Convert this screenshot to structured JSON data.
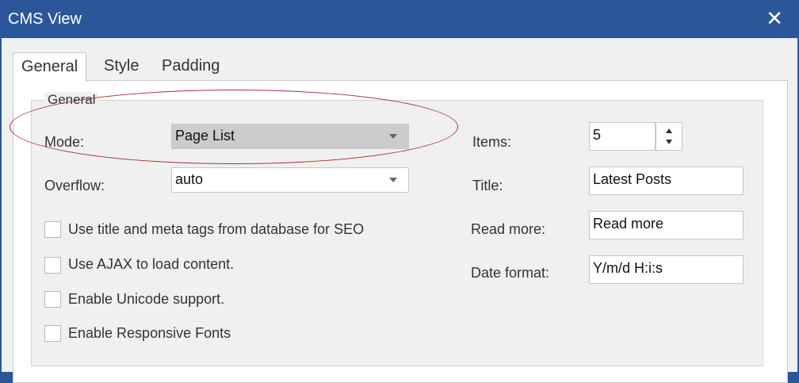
{
  "window": {
    "title": "CMS View"
  },
  "tabs": [
    {
      "label": "General"
    },
    {
      "label": "Style"
    },
    {
      "label": "Padding"
    }
  ],
  "group": {
    "label": "General"
  },
  "fields": {
    "mode": {
      "label": "Mode:",
      "value": "Page List"
    },
    "overflow": {
      "label": "Overflow:",
      "value": "auto"
    },
    "items": {
      "label": "Items:",
      "value": "5"
    },
    "title": {
      "label": "Title:",
      "value": "Latest Posts"
    },
    "read_more": {
      "label": "Read more:",
      "value": "Read more"
    },
    "date_format": {
      "label": "Date format:",
      "value": "Y/m/d H:i:s"
    }
  },
  "checkboxes": [
    {
      "label": "Use title and meta tags from database for SEO",
      "checked": false
    },
    {
      "label": "Use AJAX to load content.",
      "checked": false
    },
    {
      "label": "Enable Unicode support.",
      "checked": false
    },
    {
      "label": "Enable Responsive Fonts",
      "checked": false
    }
  ],
  "colors": {
    "titlebar": "#2b579a",
    "annotation_ellipse": "#a83232"
  }
}
